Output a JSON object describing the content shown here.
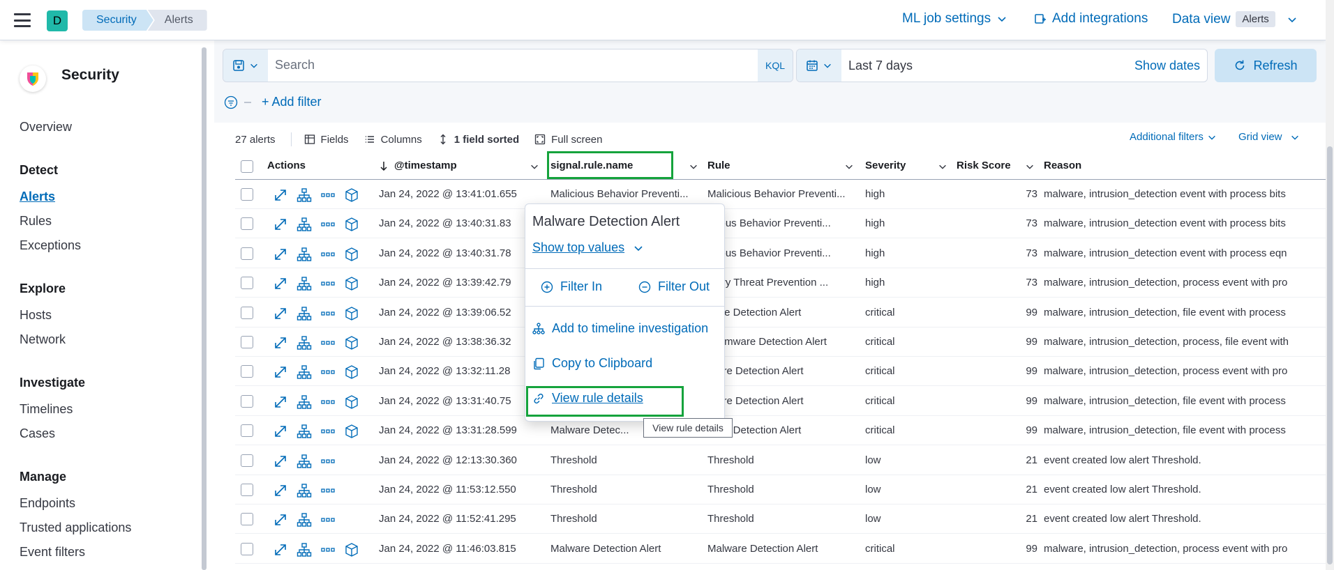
{
  "header": {
    "avatar_letter": "D",
    "breadcrumbs": [
      "Security",
      "Alerts"
    ],
    "ml_job_settings": "ML job settings",
    "add_integrations": "Add integrations",
    "data_view_label": "Data view",
    "data_view_value": "Alerts"
  },
  "sidebar": {
    "title": "Security",
    "overview": "Overview",
    "groups": {
      "detect": "Detect",
      "explore": "Explore",
      "investigate": "Investigate",
      "manage": "Manage"
    },
    "items": {
      "alerts": "Alerts",
      "rules": "Rules",
      "exceptions": "Exceptions",
      "hosts": "Hosts",
      "network": "Network",
      "timelines": "Timelines",
      "cases": "Cases",
      "endpoints": "Endpoints",
      "trusted_applications": "Trusted applications",
      "event_filters": "Event filters"
    }
  },
  "query": {
    "search_placeholder": "Search",
    "kql": "KQL",
    "date_range": "Last 7 days",
    "show_dates": "Show dates",
    "refresh": "Refresh",
    "add_filter": "+ Add filter"
  },
  "toolbar": {
    "count": "27 alerts",
    "fields": "Fields",
    "columns": "Columns",
    "sorted": "1 field sorted",
    "full_screen": "Full screen",
    "additional_filters": "Additional filters",
    "grid_view": "Grid view"
  },
  "table": {
    "headers": {
      "actions": "Actions",
      "timestamp": "@timestamp",
      "rule_name": "signal.rule.name",
      "rule": "Rule",
      "severity": "Severity",
      "risk": "Risk Score",
      "reason": "Reason"
    },
    "rows": [
      {
        "ts": "Jan 24, 2022 @ 13:41:01.655",
        "name": "Malicious Behavior Preventi...",
        "rule": "Malicious Behavior Preventi...",
        "sev": "high",
        "risk": "73",
        "reason": "malware, intrusion_detection event with process bits",
        "cube": true
      },
      {
        "ts": "Jan 24, 2022 @ 13:40:31.83",
        "name": "",
        "rule": "licious Behavior Preventi...",
        "sev": "high",
        "risk": "73",
        "reason": "malware, intrusion_detection event with process bits",
        "cube": true
      },
      {
        "ts": "Jan 24, 2022 @ 13:40:31.78",
        "name": "",
        "rule": "licious Behavior Preventi...",
        "sev": "high",
        "risk": "73",
        "reason": "malware, intrusion_detection event with process eqn",
        "cube": true
      },
      {
        "ts": "Jan 24, 2022 @ 13:39:42.79",
        "name": "",
        "rule": "mory Threat Prevention ...",
        "sev": "high",
        "risk": "73",
        "reason": "malware, intrusion_detection, process event with pro",
        "cube": true
      },
      {
        "ts": "Jan 24, 2022 @ 13:39:06.52",
        "name": "",
        "rule": "ware Detection Alert",
        "sev": "critical",
        "risk": "99",
        "reason": "malware, intrusion_detection, file event with process",
        "cube": true
      },
      {
        "ts": "Jan 24, 2022 @ 13:38:36.32",
        "name": "",
        "rule": "nsomware Detection Alert",
        "sev": "critical",
        "risk": "99",
        "reason": "malware, intrusion_detection, process, file event with",
        "cube": true
      },
      {
        "ts": "Jan 24, 2022 @ 13:32:11.28",
        "name": "",
        "rule": "lware Detection Alert",
        "sev": "critical",
        "risk": "99",
        "reason": "malware, intrusion_detection, process event with pro",
        "cube": true
      },
      {
        "ts": "Jan 24, 2022 @ 13:31:40.75",
        "name": "",
        "rule": "lware Detection Alert",
        "sev": "critical",
        "risk": "99",
        "reason": "malware, intrusion_detection, file event with process",
        "cube": true
      },
      {
        "ts": "Jan 24, 2022 @ 13:31:28.599",
        "name": "Malware Detec...",
        "rule": "ware Detection Alert",
        "sev": "critical",
        "risk": "99",
        "reason": "malware, intrusion_detection, file event with process",
        "cube": true
      },
      {
        "ts": "Jan 24, 2022 @ 12:13:30.360",
        "name": "Threshold",
        "rule": "Threshold",
        "sev": "low",
        "risk": "21",
        "reason": "event created low alert Threshold.",
        "cube": false
      },
      {
        "ts": "Jan 24, 2022 @ 11:53:12.550",
        "name": "Threshold",
        "rule": "Threshold",
        "sev": "low",
        "risk": "21",
        "reason": "event created low alert Threshold.",
        "cube": false
      },
      {
        "ts": "Jan 24, 2022 @ 11:52:41.295",
        "name": "Threshold",
        "rule": "Threshold",
        "sev": "low",
        "risk": "21",
        "reason": "event created low alert Threshold.",
        "cube": false
      },
      {
        "ts": "Jan 24, 2022 @ 11:46:03.815",
        "name": "Malware Detection Alert",
        "rule": "Malware Detection Alert",
        "sev": "critical",
        "risk": "99",
        "reason": "malware, intrusion_detection, process event with pro",
        "cube": true
      }
    ]
  },
  "popover": {
    "title": "Malware Detection Alert",
    "show_top_values": "Show top values",
    "filter_in": "Filter In",
    "filter_out": "Filter Out",
    "add_to_timeline": "Add to timeline investigation",
    "copy": "Copy to Clipboard",
    "view_rule": "View rule details",
    "tooltip": "View rule details"
  },
  "colors": {
    "link": "#006bb8",
    "highlight": "#15a33c",
    "avatar": "#20b9a9"
  }
}
